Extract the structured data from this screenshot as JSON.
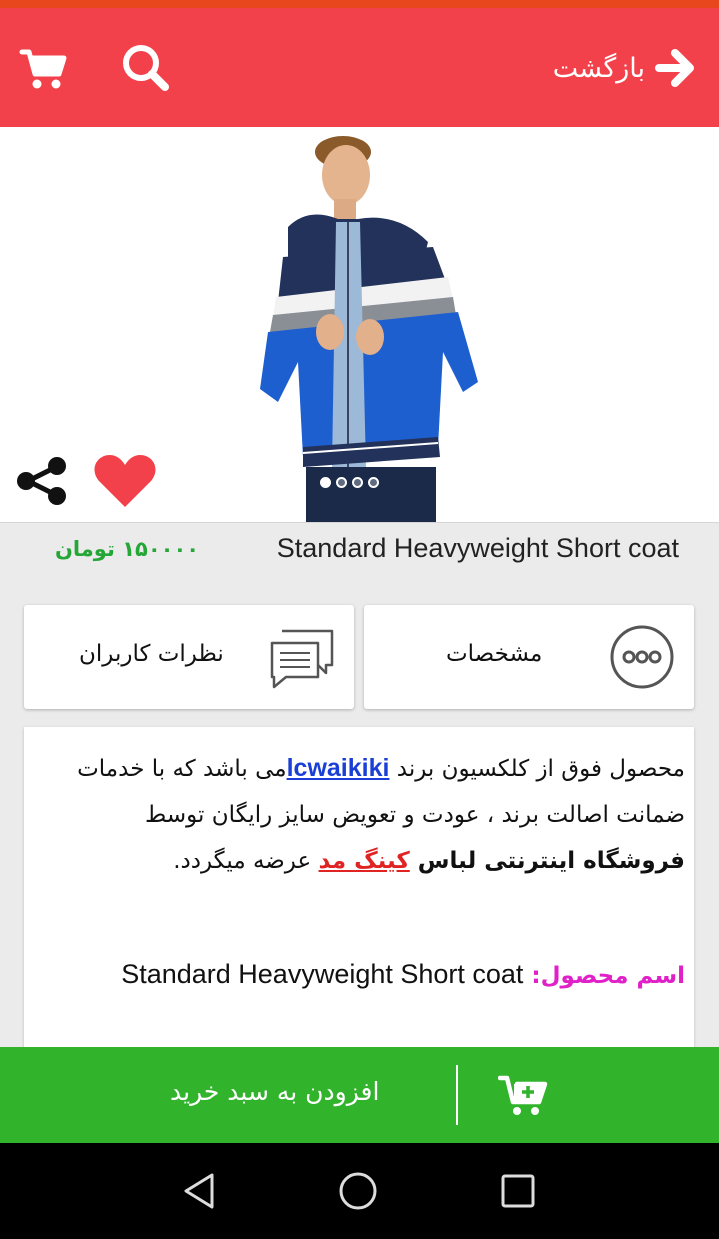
{
  "header": {
    "back_label": "بازگشت",
    "icons": [
      "cart-icon",
      "search-icon",
      "arrow-right-icon"
    ],
    "background": "#f2414a"
  },
  "gallery": {
    "image_count": 4,
    "active_index": 0,
    "icons": [
      "heart-icon",
      "share-icon"
    ],
    "heart_color": "#f2414a"
  },
  "product": {
    "title": "Standard Heavyweight Short coat",
    "price": "۱۵۰۰۰۰ تومان",
    "price_color": "#25a637"
  },
  "tabs": {
    "specs_label": "مشخصات",
    "reviews_label": "نظرات کاربران"
  },
  "description": {
    "part1": "محصول فوق از کلکسیون برند ",
    "brand": "lcwaikiki",
    "part2": "می باشد که با خدمات ضمانت اصالت برند ، عودت و تعویض سایز رایگان توسط ",
    "store_bold": "فروشگاه اینترنتی لباس ",
    "store_link": "کینگ مد",
    "part3": " عرضه میگردد.",
    "name_label": "اسم محصول:",
    "name_value": "Standard Heavyweight Short coat",
    "brand_color": "#1a3fd6",
    "store_color": "#e02424",
    "label_color": "#e020c8"
  },
  "add_to_cart": {
    "label": "افزودن به سبد خرید",
    "background": "#31b32b"
  },
  "system_nav": {
    "icons": [
      "nav-back-icon",
      "nav-home-icon",
      "nav-recent-icon"
    ]
  }
}
